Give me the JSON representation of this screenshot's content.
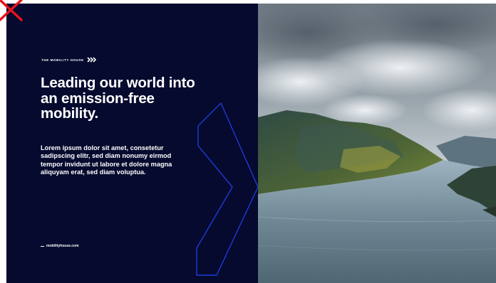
{
  "slide": {
    "brand": "THE MOBILITY HOUSE",
    "headline": "Leading our world into an emission-free mobility.",
    "body": "Lorem ipsum dolor sit amet, consetetur sadipscing elitr, sed diam nonumy eirmod tempor invidunt ut labore et dolore magna aliquyam erat, sed diam voluptua.",
    "footer_link": "mobilityhouse.com"
  },
  "icons": {
    "close": "close-icon",
    "brand_mark": "chevrons-icon"
  },
  "colors": {
    "panel_background": "#050a2e",
    "outline_accent": "#1e3ad8",
    "close_mark": "#e8141b",
    "text": "#ffffff"
  }
}
